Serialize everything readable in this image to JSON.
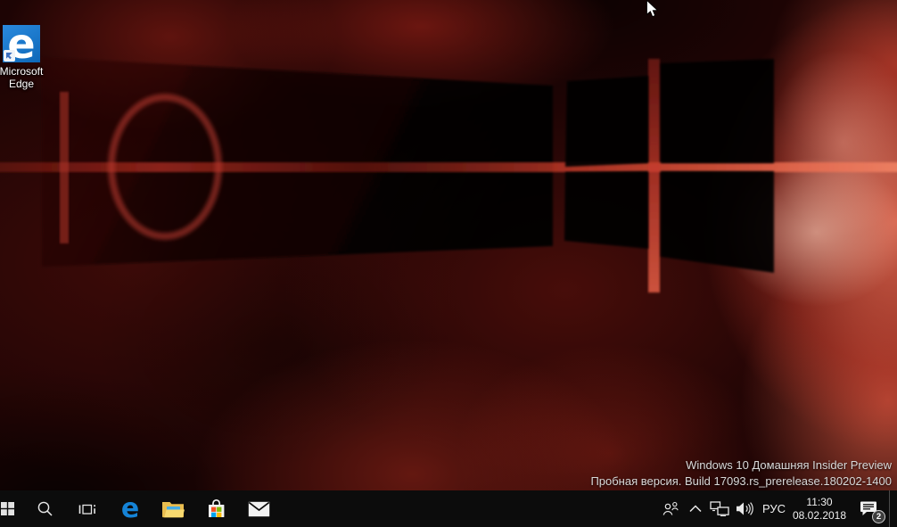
{
  "desktop": {
    "watermark": {
      "line1": "Windows 10 Домашняя Insider Preview",
      "line2": "Пробная версия. Build 17093.rs_prerelease.180202-1400"
    },
    "icons": [
      {
        "name": "Microsoft Edge",
        "label_line1": "Microsoft",
        "label_line2": "Edge",
        "glyph": "e"
      }
    ]
  },
  "taskbar": {
    "edge_glyph": "e",
    "buttons": [
      "start",
      "search",
      "task-view",
      "edge",
      "file-explorer",
      "store",
      "mail"
    ],
    "tray": {
      "icons": [
        "people",
        "show-hidden-icons",
        "ethernet-network",
        "volume",
        "action-center"
      ],
      "language": "РУС",
      "time": "11:30",
      "date": "08.02.2018",
      "notification_badge": "2"
    }
  },
  "colors": {
    "edge_blue": "#1583d6",
    "tile_blue": "#1176cf",
    "taskbar_bg": "#0c0c0c",
    "folder_yellow": "#eec455",
    "folder_front": "#f7d96f",
    "folder_blue": "#45aee8",
    "store_red": "#f25022",
    "store_green": "#7fba00",
    "store_blue": "#00a4ef",
    "store_yellow": "#ffb900",
    "wallpaper_red": "#c23327"
  }
}
